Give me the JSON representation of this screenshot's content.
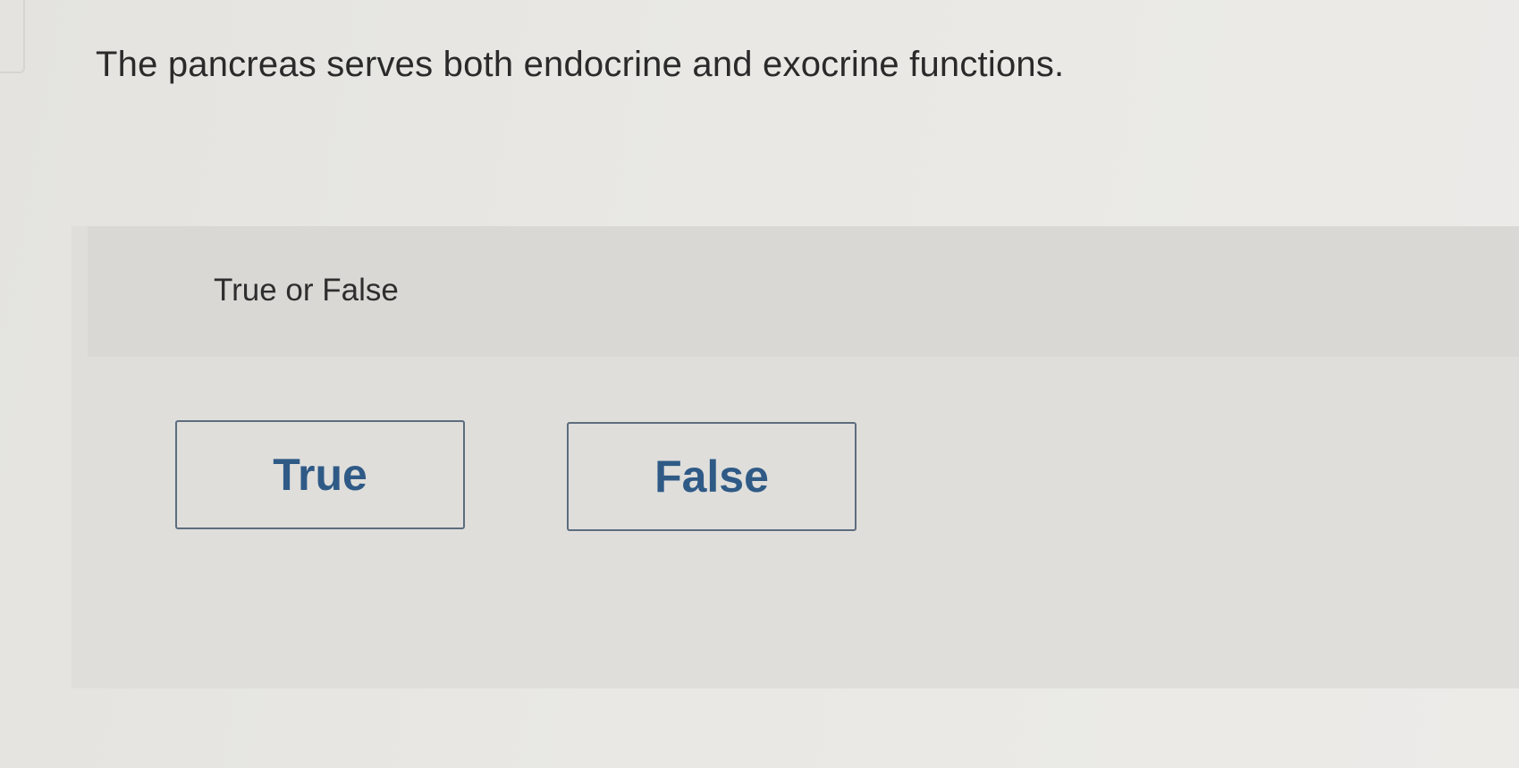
{
  "question": {
    "text": "The pancreas serves both endocrine and exocrine functions."
  },
  "answer_panel": {
    "prompt": "True or False",
    "options": [
      {
        "label": "True"
      },
      {
        "label": "False"
      }
    ]
  }
}
